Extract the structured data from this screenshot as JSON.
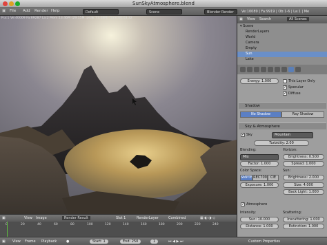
{
  "window": {
    "title": "SunSkyAtmosphere.blend"
  },
  "menu": {
    "file": "File",
    "add": "Add",
    "render": "Render",
    "help": "Help",
    "layout": "Default",
    "scene": "Scene",
    "engine": "Blender Render",
    "stats": "Ve:10089 | Fa:9919 | Ob:1-6 | La:1 | Me"
  },
  "viewport": {
    "info": "Fra:1  Ve:40009 Fa:69287 La:2 Mem:13.46M (29.15M, peak 73.48M) Time:00:03.32"
  },
  "imgheader": {
    "view": "View",
    "image": "Image",
    "name": "Render Result",
    "slot": "Slot 1",
    "layer": "RenderLayer",
    "pass": "Combined"
  },
  "timeline": {
    "ticks": [
      "0",
      "20",
      "40",
      "60",
      "80",
      "100",
      "120",
      "140",
      "160",
      "180",
      "200",
      "220",
      "240"
    ],
    "view": "View",
    "frame": "Frame",
    "playback": "Playback",
    "start": "Start: 1",
    "end": "End: 250",
    "current": "1"
  },
  "outliner": {
    "view": "View",
    "search": "Search",
    "filter": "All Scenes",
    "items": [
      "Scene",
      "RenderLayers",
      "World",
      "Camera",
      "Empty",
      "Sun",
      "Lake"
    ]
  },
  "props": {
    "energy": "Energy: 1.000",
    "this_layer": "This Layer Only",
    "specular": "Specular",
    "diffuse": "Diffuse",
    "shadow_title": "Shadow",
    "no_shadow": "No Shadow",
    "ray_shadow": "Ray Shadow",
    "sky_title": "Sky & Atmosphere",
    "sky": "Sky",
    "sky_type": "Mountain",
    "turbidity": "Turbidity: 2.00",
    "blending": "Blending:",
    "horizon": "Horizon:",
    "blend_mode": "Mix",
    "brightness1": "Brightness: 0.500",
    "factor": "Factor: 1.000",
    "spread": "Spread: 1.000",
    "color_space": "Color Space:",
    "sun": "Sun:",
    "cs1": "SMPTE",
    "cs2": "REC709",
    "cs3": "CIE",
    "brightness2": "Brightness: 2.000",
    "exposure": "Exposure: 1.000",
    "size": "Size: 4.000",
    "back_light": "Back Light: 1.000",
    "atmosphere": "Atmosphere",
    "intensity": "Intensity:",
    "scattering": "Scattering:",
    "sun_int": "Sun: 10.000",
    "inscatter": "Inscattering: 1.000",
    "distance": "Distance: 1.000",
    "extinction": "Extinction: 1.000",
    "custom": "Custom Properties"
  }
}
